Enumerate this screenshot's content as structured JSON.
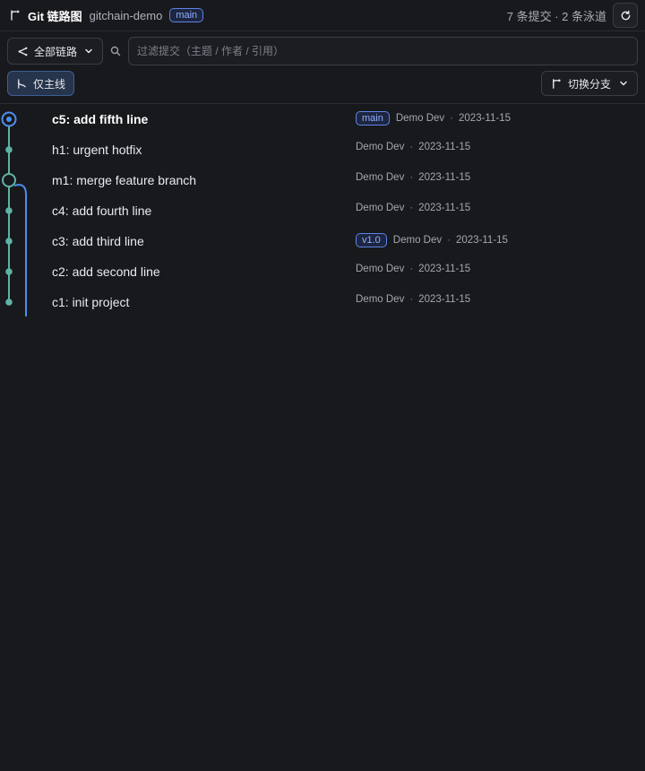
{
  "header": {
    "title": "Git 链路图",
    "repo": "gitchain-demo",
    "current_branch": "main",
    "stats": "7 条提交 · 2 条泳道"
  },
  "toolbar": {
    "lanes_filter_label": "全部链路",
    "search_placeholder": "过滤提交（主题 / 作者 / 引用）",
    "search_value": "",
    "mainline_only_label": "仅主线",
    "switch_branch_label": "切换分支"
  },
  "commits": [
    {
      "subject": "c5: add fifth line",
      "ref": "main",
      "author": "Demo Dev",
      "date": "2023-11-15",
      "head": true
    },
    {
      "subject": "h1: urgent hotfix",
      "ref": "",
      "author": "Demo Dev",
      "date": "2023-11-15",
      "head": false
    },
    {
      "subject": "m1: merge feature branch",
      "ref": "",
      "author": "Demo Dev",
      "date": "2023-11-15",
      "head": false
    },
    {
      "subject": "c4: add fourth line",
      "ref": "",
      "author": "Demo Dev",
      "date": "2023-11-15",
      "head": false
    },
    {
      "subject": "c3: add third line",
      "ref": "v1.0",
      "author": "Demo Dev",
      "date": "2023-11-15",
      "head": false
    },
    {
      "subject": "c2: add second line",
      "ref": "",
      "author": "Demo Dev",
      "date": "2023-11-15",
      "head": false
    },
    {
      "subject": "c1: init project",
      "ref": "",
      "author": "Demo Dev",
      "date": "2023-11-15",
      "head": false
    }
  ],
  "colors": {
    "lane_main": "#5fb3a4",
    "lane_branch": "#4d8ef0",
    "accent": "#5b84e6"
  },
  "icons": {
    "header": "git-branch-icon",
    "refresh": "refresh-icon",
    "lanes": "git-graph-icon",
    "search": "search-icon",
    "mainline": "git-merge-icon",
    "switch_branch": "git-branch-icon"
  }
}
